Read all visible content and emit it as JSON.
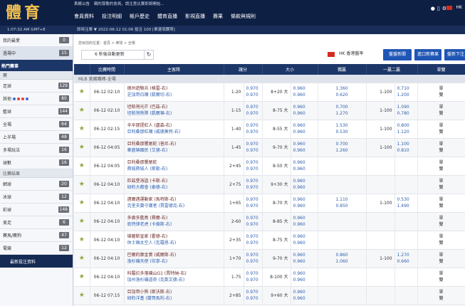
{
  "brand": {
    "logo_text": "體育"
  },
  "system_message": {
    "label": "系統公告",
    "text": "親的尊敬的會員，請注意比賽即將開始..."
  },
  "nav": [
    "會員資料",
    "投注明細",
    "帳戶歷史",
    "體育直播",
    "影視直播",
    "賽果",
    "條款與規則"
  ],
  "top_right": {
    "language": "HK"
  },
  "subbar": {
    "clock": "1:07:32 AM GMT+8",
    "info": "即時注單 ▼  2022-06-12 01:06 投注 100 [單選項賽照]"
  },
  "sidebar": {
    "top_items": [
      {
        "label": "我的最愛",
        "count": "0"
      },
      {
        "label": "過場中",
        "count": "15"
      }
    ],
    "section_header": "熱門賽事",
    "sub_header": "賽",
    "items": [
      {
        "label": "足球",
        "count": "129"
      },
      {
        "label": "其他",
        "count": "80"
      },
      {
        "label": "籃球",
        "count": "144"
      },
      {
        "label": "全場",
        "count": "64"
      },
      {
        "label": "上半場",
        "count": "48"
      },
      {
        "label": "多場玩法",
        "count": "16"
      },
      {
        "label": "球數",
        "count": "16"
      }
    ],
    "sub_header2": "比賽結果",
    "items2": [
      {
        "label": "網球",
        "count": "20"
      },
      {
        "label": "冰球",
        "count": "12"
      },
      {
        "label": "彩球",
        "count": "148"
      },
      {
        "label": "美足",
        "count": "6"
      },
      {
        "label": "賽馬/賽狗",
        "count": "47"
      },
      {
        "label": "電競",
        "count": "12"
      }
    ],
    "favorite_label": "最新投注資料"
  },
  "content": {
    "breadcrumb": "您目前的位置：首頁 > 棒球 > 全場",
    "refresh_label": "6 秒後自動更新",
    "odds_type": "HK  香港盤率",
    "buttons": [
      "盤盤新聞",
      "進口新賽果",
      "盤新下注"
    ],
    "columns": [
      "",
      "比賽時間",
      "主客隊",
      "讓分",
      "",
      "大小",
      "",
      "獨贏",
      "一贏二贏",
      "",
      "單雙"
    ],
    "league": "MLB  美國職棒-全場",
    "rows": [
      {
        "time": "06-12 02:10",
        "home": "德州遊騎兵 (格雷-右)",
        "away": "芝加哥白襪 (凱爾切-右)",
        "hc": [
          "",
          "1-20"
        ],
        "hco": [
          "0.970",
          "0.970"
        ],
        "ou": [
          "8+20 大",
          ""
        ],
        "ouo": [
          "0.960",
          "0.960"
        ],
        "ml": [
          "1.360",
          "0.620"
        ],
        "wl": [
          "",
          "1-100"
        ],
        "wlo": [
          "0.710",
          "1.200"
        ],
        "oe": [
          "單",
          "雙"
        ]
      },
      {
        "time": "06-12 02:10",
        "home": "坦帕灣光芒 (巴茲-右)",
        "away": "坦帕灣熊隊 (凱爾頓-右)",
        "hc": [
          "1-15",
          ""
        ],
        "hco": [
          "0.970",
          "0.970"
        ],
        "ou": [
          "8-75 大",
          ""
        ],
        "ouo": [
          "0.960",
          "0.960"
        ],
        "ml": [
          "0.700",
          "1.270"
        ],
        "wl": [
          "1-100",
          ""
        ],
        "wlo": [
          "1.090",
          "0.780"
        ],
        "oe": [
          "單",
          "雙"
        ]
      },
      {
        "time": "06-12 02:15",
        "home": "辛辛那提紅人 (盧森-右)",
        "away": "亞利桑那紅襪 (威德莫特-右)",
        "hc": [
          "",
          "1-40"
        ],
        "hco": [
          "0.970",
          "0.970"
        ],
        "ou": [
          "8-55 大",
          ""
        ],
        "ouo": [
          "0.960",
          "0.960"
        ],
        "ml": [
          "1.530",
          "0.530"
        ],
        "wl": [
          "",
          "1-100"
        ],
        "wlo": [
          "0.800",
          "1.120"
        ],
        "oe": [
          "單",
          "雙"
        ]
      },
      {
        "time": "06-12 04:05",
        "home": "亞利桑那響尾蛇 (普尼-右)",
        "away": "華盛頓國民 (艾德-右)",
        "hc": [
          "1-45",
          ""
        ],
        "hco": [
          "0.970",
          "0.970"
        ],
        "ou": [
          "9-70 大",
          ""
        ],
        "ouo": [
          "0.960",
          "0.960"
        ],
        "ml": [
          "0.700",
          "1.260"
        ],
        "wl": [
          "1-100",
          ""
        ],
        "wlo": [
          "1.100",
          "0.810"
        ],
        "oe": [
          "單",
          "雙"
        ]
      },
      {
        "time": "06-12 04:05",
        "home": "亞利桑那響尾蛇",
        "away": "費城費城人 (斯勒-右)",
        "hc": [
          "",
          "2+45"
        ],
        "hco": [
          "0.970",
          "0.970"
        ],
        "ou": [
          "8-50 大",
          ""
        ],
        "ouo": [
          "0.960",
          "0.960"
        ],
        "ml": [
          "",
          ""
        ],
        "wl": [
          "",
          ""
        ],
        "wlo": [
          "",
          ""
        ],
        "oe": [
          "單",
          "雙"
        ]
      },
      {
        "time": "06-12 04:10",
        "home": "匹茲堡海盜 (卡斯-右)",
        "away": "紐約大都會 (泰德-右)",
        "hc": [
          "",
          "2+75"
        ],
        "hco": [
          "0.970",
          "0.970"
        ],
        "ou": [
          "9+30 大",
          ""
        ],
        "ouo": [
          "0.960",
          "0.960"
        ],
        "ml": [
          "",
          ""
        ],
        "wl": [
          "",
          ""
        ],
        "wlo": [
          "",
          ""
        ],
        "oe": [
          "單",
          "雙"
        ]
      },
      {
        "time": "06-12 04:10",
        "home": "邁爾邁運動家 (馬特斯-右)",
        "away": "克里夫蘭守護者 (賈雷德克-右)",
        "hc": [
          "",
          "1+65"
        ],
        "hco": [
          "0.970",
          "0.970"
        ],
        "ou": [
          "8-70 大",
          ""
        ],
        "ouo": [
          "0.960",
          "0.960"
        ],
        "ml": [
          "1.110",
          "0.850"
        ],
        "wl": [
          "",
          "1-100"
        ],
        "wlo": [
          "0.530",
          "1.490"
        ],
        "oe": [
          "單",
          "雙"
        ]
      },
      {
        "time": "06-12 04:10",
        "home": "多倫多藍鳥 (費爾-右)",
        "away": "底特律老虎 (卡倫斯-右)",
        "hc": [
          "2-60",
          ""
        ],
        "hco": [
          "0.970",
          "0.970"
        ],
        "ou": [
          "8-85 大",
          ""
        ],
        "ouo": [
          "0.960",
          "0.960"
        ],
        "ml": [
          "",
          ""
        ],
        "wl": [
          "",
          ""
        ],
        "wlo": [
          "",
          ""
        ],
        "oe": [
          "單",
          "雙"
        ]
      },
      {
        "time": "06-12 04:10",
        "home": "堪薩斯皇家 (霍德-右)",
        "away": "休士頓太空人 (瓦羅恩-右)",
        "hc": [
          "",
          "2+35"
        ],
        "hco": [
          "0.970",
          "0.970"
        ],
        "ou": [
          "8-75 大",
          ""
        ],
        "ouo": [
          "0.960",
          "0.960"
        ],
        "ml": [
          "",
          ""
        ],
        "wl": [
          "",
          ""
        ],
        "wlo": [
          "",
          ""
        ],
        "oe": [
          "單",
          "雙"
        ]
      },
      {
        "time": "06-12 04:10",
        "home": "巴爾的摩金鶯 (威爾斯-右)",
        "away": "洛杉磯天使 (坎寧-右)",
        "hc": [
          "1+70",
          ""
        ],
        "hco": [
          "0.970",
          "0.970"
        ],
        "ou": [
          "9-70 大",
          ""
        ],
        "ouo": [
          "0.960",
          "0.960"
        ],
        "ml": [
          "0.860",
          "1.060"
        ],
        "wl": [
          "1-100",
          ""
        ],
        "wlo": [
          "1.270",
          "0.660"
        ],
        "oe": [
          "單",
          "雙"
        ]
      },
      {
        "time": "06-12 04:10",
        "home": "科羅拉多落磯山G1 (賈特納-右)",
        "away": "加州洛杉磯道奇 (克萊文德-右)",
        "hc": [
          "",
          "1-75"
        ],
        "hco": [
          "0.970",
          "0.970"
        ],
        "ou": [
          "8-100 大",
          ""
        ],
        "ouo": [
          "0.960",
          "0.960"
        ],
        "ml": [
          "",
          ""
        ],
        "wl": [
          "",
          ""
        ],
        "wlo": [
          "",
          ""
        ],
        "oe": [
          "單",
          "雙"
        ]
      },
      {
        "time": "06-12 07:15",
        "home": "亞加哥小熊 (斯沃斯-右)",
        "away": "紐約洋基 (蘭哥馬利-右)",
        "hc": [
          "",
          "2+85"
        ],
        "hco": [
          "0.970",
          "0.970"
        ],
        "ou": [
          "9+60 大",
          ""
        ],
        "ouo": [
          "0.960",
          "0.960"
        ],
        "ml": [
          "",
          ""
        ],
        "wl": [
          "",
          ""
        ],
        "wlo": [
          "",
          ""
        ],
        "oe": [
          "單",
          "雙"
        ]
      }
    ]
  }
}
